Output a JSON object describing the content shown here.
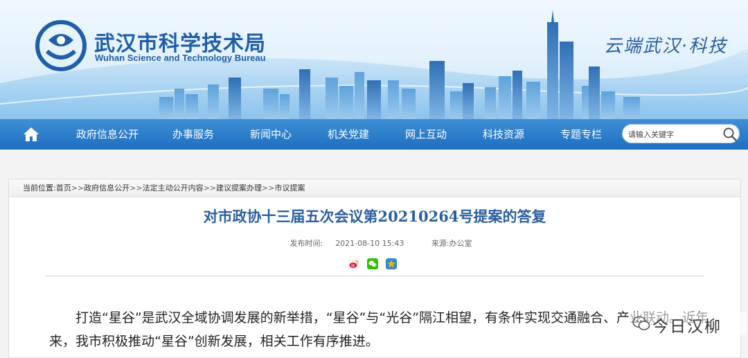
{
  "header": {
    "site_name_cn": "武汉市科学技术局",
    "site_name_en": "Wuhan Science and Technology Bureau",
    "slogan": "云端武汉·科技"
  },
  "nav": {
    "items": [
      {
        "label": "政府信息公开"
      },
      {
        "label": "办事服务"
      },
      {
        "label": "新闻中心"
      },
      {
        "label": "机关党建"
      },
      {
        "label": "网上互动"
      },
      {
        "label": "科技资源"
      },
      {
        "label": "专题专栏"
      }
    ],
    "search_placeholder": "请输入关键字"
  },
  "breadcrumb": {
    "label": "当前位置:",
    "items": [
      "首页",
      "政府信息公开",
      "法定主动公开内容",
      "建议提案办理",
      "市议提案"
    ],
    "separator": ">>"
  },
  "article": {
    "title": "对市政协十三届五次会议第20210264号提案的答复",
    "publish_label": "发布时间:",
    "publish_time": "2021-08-10 15:43",
    "source_label": "来源:",
    "source": "办公室",
    "body": "打造“星谷”是武汉全域协调发展的新举措，“星谷”与“光谷”隔江相望，有条件实现交通融合、产业联动。近年来，我市积极推动“星谷”创新发展，相关工作有序推进。"
  },
  "share": {
    "icons": [
      "weibo-icon",
      "wechat-icon",
      "qzone-icon"
    ],
    "colors": {
      "weibo": "#e6162d",
      "wechat": "#2dc100",
      "qzone": "#f5b400"
    }
  },
  "watermark": {
    "text": "今日汉柳"
  },
  "colors": {
    "nav_bg": "#1d6fc0",
    "title": "#2b5f9e",
    "brand": "#1f5ea8"
  }
}
